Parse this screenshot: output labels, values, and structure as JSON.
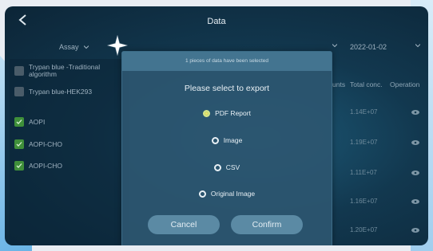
{
  "header": {
    "title": "Data"
  },
  "filters": {
    "assay_label": "Assay",
    "date_value": "2022-01-02"
  },
  "columns": {
    "counts_partial": "unts",
    "total_conc": "Total conc.",
    "operation": "Operation"
  },
  "sidebar": {
    "items": [
      {
        "label_line1": "Trypan blue -Traditional",
        "label_line2": "algorithm",
        "checked": false
      },
      {
        "label": "Trypan blue-HEK293",
        "checked": false
      },
      {
        "label": "AOPI",
        "checked": true
      },
      {
        "label": "AOPI-CHO",
        "checked": true
      },
      {
        "label": "AOPI-CHO",
        "checked": true
      }
    ]
  },
  "table": {
    "total_conc_values": [
      "1.14E+07",
      "1.19E+07",
      "1.11E+07",
      "1.16E+07",
      "1.20E+07"
    ]
  },
  "modal": {
    "header": "1 pieces of data have been selected",
    "prompt": "Please select to export",
    "options": [
      "PDF Report",
      "Image",
      "CSV",
      "Original Image"
    ],
    "selected_option": "PDF Report",
    "cancel_label": "Cancel",
    "confirm_label": "Confirm"
  },
  "icons": {
    "back": "chevron-left-icon",
    "eye": "eye-icon",
    "check": "check-icon",
    "sparkle": "sparkle-icon"
  },
  "colors": {
    "accent_green": "#3f8f3a",
    "modal_bg": "#2c5670",
    "button_bg": "#5b8aa4",
    "selected_radio": "#f2e36b"
  }
}
